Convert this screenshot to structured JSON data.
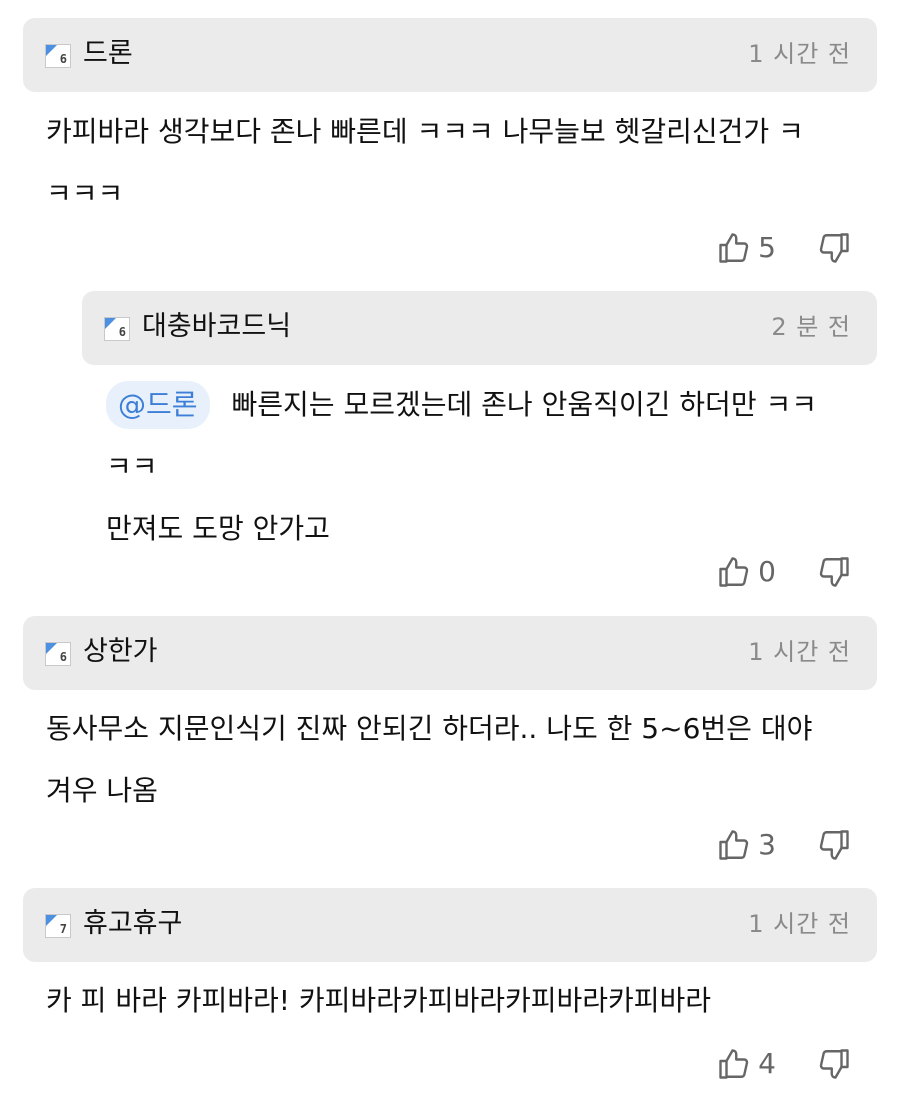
{
  "comments": [
    {
      "author": "드론",
      "level": "6",
      "time": "1 시간 전",
      "lines": [
        "카피바라 생각보다 존나 빠른데 ㅋㅋㅋ 나무늘보 헷갈리신건가 ㅋ",
        "ㅋㅋㅋ"
      ],
      "likes": "5"
    },
    {
      "author": "대충바코드닉",
      "level": "6",
      "time": "2 분 전",
      "mention": "@드론",
      "lines": [
        "빠른지는 모르겠는데 존나 안움직이긴 하더만 ㅋㅋ",
        "ㅋㅋ",
        "만져도 도망 안가고"
      ],
      "likes": "0"
    },
    {
      "author": "상한가",
      "level": "6",
      "time": "1 시간 전",
      "lines": [
        "동사무소 지문인식기 진짜 안되긴 하더라.. 나도 한 5~6번은 대야",
        "겨우 나옴"
      ],
      "likes": "3"
    },
    {
      "author": "휴고휴구",
      "level": "7",
      "time": "1 시간 전",
      "lines": [
        "카 피 바라 카피바라! 카피바라카피바라카피바라카피바라"
      ],
      "likes": "4"
    }
  ],
  "icons": {
    "like": "thumbs-up-icon",
    "dislike": "thumbs-down-icon",
    "badge": "level-badge-icon"
  },
  "colors": {
    "header_bg": "#ebebeb",
    "mention_bg": "#e8f1fb",
    "mention_text": "#3d7fd6",
    "badge_corner": "#4d8fe0",
    "meta_text": "#8a8a8a"
  }
}
